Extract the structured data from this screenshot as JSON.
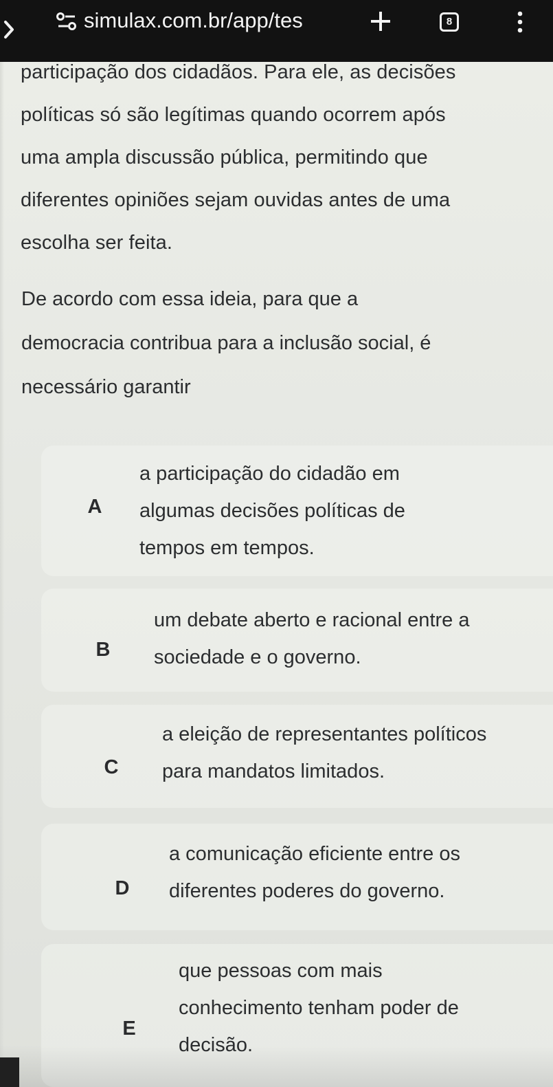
{
  "browser": {
    "url": "simulax.com.br/app/tes",
    "tab_count": "8",
    "icons": {
      "back": "back-arrow-icon",
      "site_settings": "site-settings-icon",
      "new_tab": "plus-icon",
      "menu": "more-vertical-icon"
    }
  },
  "passage": {
    "lines": [
      "participação dos cidadãos. Para ele, as decisões",
      "políticas só são legítimas quando ocorrem após",
      "uma ampla discussão pública, permitindo que",
      "diferentes opiniões sejam ouvidas antes de uma",
      "escolha ser feita."
    ]
  },
  "question": {
    "lines": [
      "De acordo com essa ideia, para que a",
      "democracia contribua para a inclusão social, é",
      "necessário garantir"
    ]
  },
  "options": [
    {
      "letter": "A",
      "lines": [
        "a participação do cidadão em",
        "algumas decisões políticas de",
        "tempos em tempos."
      ]
    },
    {
      "letter": "B",
      "lines": [
        "um debate aberto e racional entre a",
        "sociedade e o governo."
      ]
    },
    {
      "letter": "C",
      "lines": [
        "a eleição de representantes políticos",
        "para mandatos limitados."
      ]
    },
    {
      "letter": "D",
      "lines": [
        "a comunicação eficiente entre os",
        "diferentes poderes do governo."
      ]
    },
    {
      "letter": "E",
      "lines": [
        "que pessoas com mais",
        "conhecimento tenham poder de",
        "decisão."
      ]
    }
  ]
}
